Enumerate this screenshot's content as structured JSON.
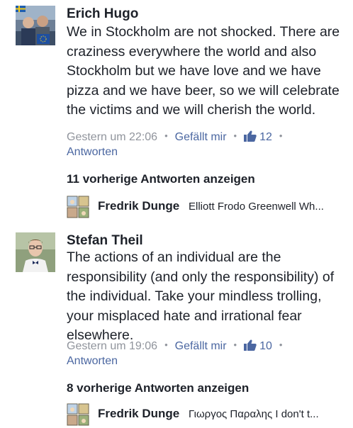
{
  "comments": [
    {
      "author": "Erich Hugo",
      "text": "We in Stockholm are not shocked. There are craziness everywhere the world and also Stockholm but we have love and we have pizza and we have beer, so we will celebrate the victims and we will cherish the world.",
      "time": "Gestern um 22:06",
      "like_label": "Gefällt mir",
      "like_count": "12",
      "reply_label": "Antworten",
      "show_replies": "11 vorherige Antworten anzeigen",
      "reply_preview": {
        "author": "Fredrik Dunge",
        "text": "Elliott Frodo Greenwell Wh..."
      }
    },
    {
      "author": "Stefan Theil",
      "text": "The actions of an individual are the responsibility (and only the responsibility) of the individual. Take your mindless trolling, your misplaced hate and irrational fear elsewhere.",
      "time": "Gestern um 19:06",
      "like_label": "Gefällt mir",
      "like_count": "10",
      "reply_label": "Antworten",
      "show_replies": "8 vorherige Antworten anzeigen",
      "reply_preview": {
        "author": "Fredrik Dunge",
        "text": "Γιωργος Παραλης I don't t..."
      }
    }
  ],
  "colors": {
    "text": "#1d2129",
    "meta": "#90949c",
    "link": "#4b67a1"
  },
  "icons": {
    "like": "thumbs-up-icon"
  }
}
